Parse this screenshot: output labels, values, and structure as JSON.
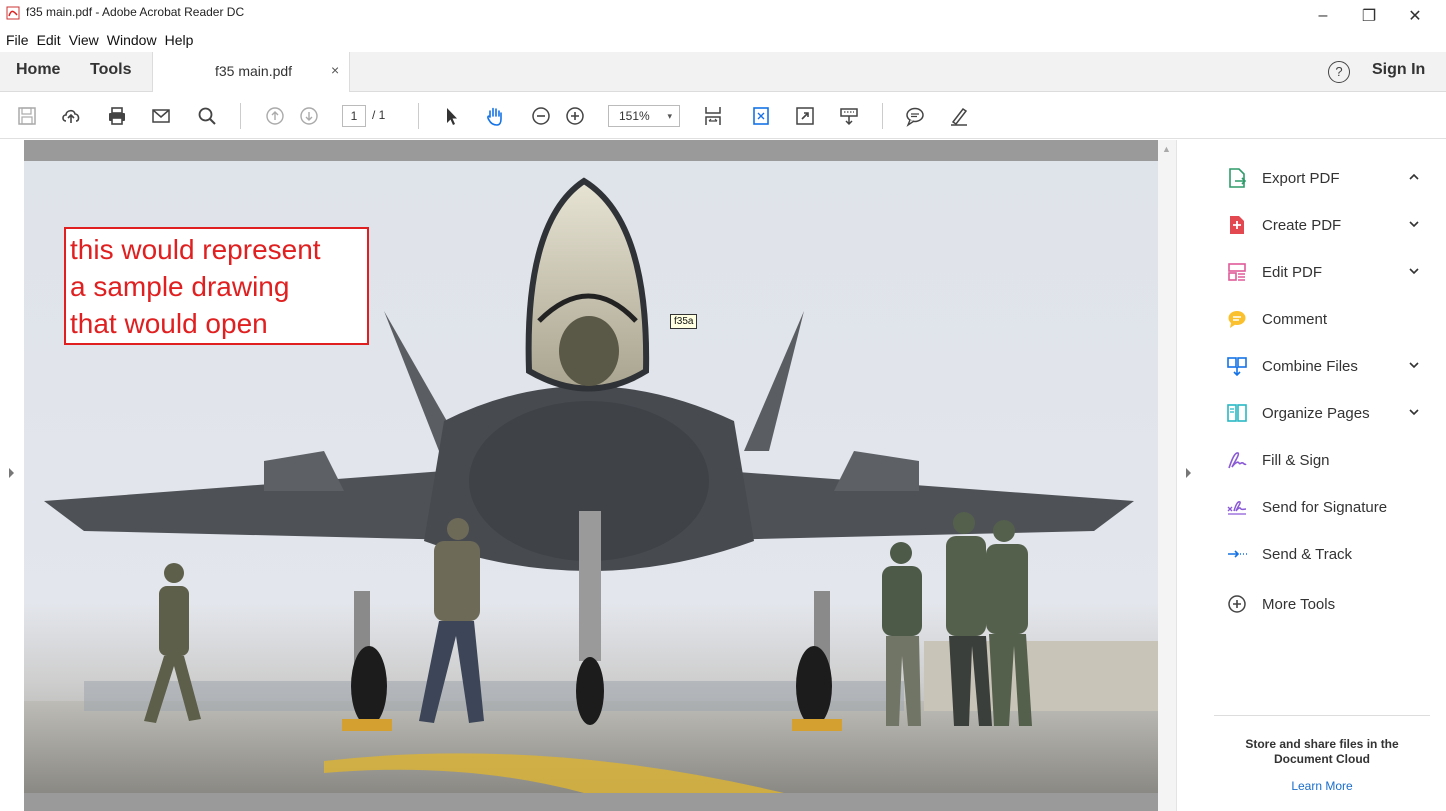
{
  "window": {
    "title": "f35 main.pdf - Adobe Acrobat Reader DC",
    "minimize_glyph": "–",
    "maximize_glyph": "❐",
    "close_glyph": "✕"
  },
  "menu": {
    "items": [
      "File",
      "Edit",
      "View",
      "Window",
      "Help"
    ]
  },
  "tabs": {
    "home": "Home",
    "tools": "Tools",
    "document": "f35 main.pdf",
    "close_glyph": "×"
  },
  "header_right": {
    "help_glyph": "?",
    "sign_in": "Sign In"
  },
  "toolbar": {
    "page_current": "1",
    "page_total": "/ 1",
    "zoom": "151%",
    "zoom_caret": "▾"
  },
  "document": {
    "annotation_lines": [
      "this would represent",
      "a sample drawing",
      "that would open"
    ],
    "tooltip": "f35a",
    "annotation_color": "#e02020"
  },
  "right_panel": {
    "items": [
      {
        "label": "Export PDF",
        "icon": "export-pdf-icon",
        "chevron": "up"
      },
      {
        "label": "Create PDF",
        "icon": "create-pdf-icon",
        "chevron": "down"
      },
      {
        "label": "Edit PDF",
        "icon": "edit-pdf-icon",
        "chevron": "down"
      },
      {
        "label": "Comment",
        "icon": "comment-icon",
        "chevron": ""
      },
      {
        "label": "Combine Files",
        "icon": "combine-files-icon",
        "chevron": "down"
      },
      {
        "label": "Organize Pages",
        "icon": "organize-pages-icon",
        "chevron": "down"
      },
      {
        "label": "Fill & Sign",
        "icon": "fill-sign-icon",
        "chevron": ""
      },
      {
        "label": "Send for Signature",
        "icon": "send-signature-icon",
        "chevron": ""
      },
      {
        "label": "Send & Track",
        "icon": "send-track-icon",
        "chevron": ""
      },
      {
        "label": "More Tools",
        "icon": "more-tools-icon",
        "chevron": ""
      }
    ],
    "cloud_line1": "Store and share files in the",
    "cloud_line2": "Document Cloud",
    "learn_more": "Learn More",
    "link_color": "#1a6ecb"
  }
}
